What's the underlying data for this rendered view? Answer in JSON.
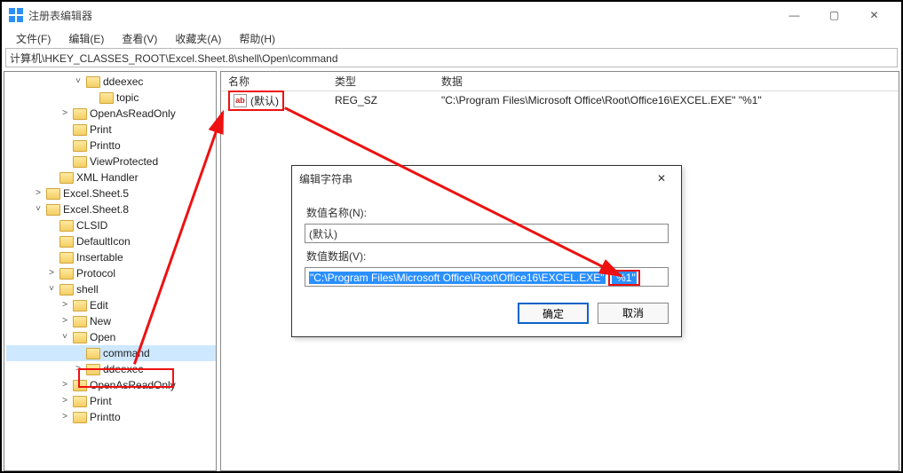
{
  "window": {
    "title": "注册表编辑器",
    "controls": {
      "min": "—",
      "max": "▢",
      "close": "✕"
    }
  },
  "menu": [
    "文件(F)",
    "编辑(E)",
    "查看(V)",
    "收藏夹(A)",
    "帮助(H)"
  ],
  "address": "计算机\\HKEY_CLASSES_ROOT\\Excel.Sheet.8\\shell\\Open\\command",
  "tree": [
    {
      "indent": 5,
      "exp": "v",
      "label": "ddeexec"
    },
    {
      "indent": 6,
      "exp": "",
      "label": "topic"
    },
    {
      "indent": 4,
      "exp": ">",
      "label": "OpenAsReadOnly"
    },
    {
      "indent": 4,
      "exp": "",
      "label": "Print"
    },
    {
      "indent": 4,
      "exp": "",
      "label": "Printto"
    },
    {
      "indent": 4,
      "exp": "",
      "label": "ViewProtected"
    },
    {
      "indent": 3,
      "exp": "",
      "label": "XML Handler"
    },
    {
      "indent": 2,
      "exp": ">",
      "label": "Excel.Sheet.5"
    },
    {
      "indent": 2,
      "exp": "v",
      "label": "Excel.Sheet.8"
    },
    {
      "indent": 3,
      "exp": "",
      "label": "CLSID"
    },
    {
      "indent": 3,
      "exp": "",
      "label": "DefaultIcon"
    },
    {
      "indent": 3,
      "exp": "",
      "label": "Insertable"
    },
    {
      "indent": 3,
      "exp": ">",
      "label": "Protocol"
    },
    {
      "indent": 3,
      "exp": "v",
      "label": "shell"
    },
    {
      "indent": 4,
      "exp": ">",
      "label": "Edit"
    },
    {
      "indent": 4,
      "exp": ">",
      "label": "New"
    },
    {
      "indent": 4,
      "exp": "v",
      "label": "Open"
    },
    {
      "indent": 5,
      "exp": "",
      "label": "command",
      "hl": true
    },
    {
      "indent": 5,
      "exp": ">",
      "label": "ddeexec"
    },
    {
      "indent": 4,
      "exp": ">",
      "label": "OpenAsReadOnly"
    },
    {
      "indent": 4,
      "exp": ">",
      "label": "Print"
    },
    {
      "indent": 4,
      "exp": ">",
      "label": "Printto"
    }
  ],
  "list": {
    "headers": {
      "name": "名称",
      "type": "类型",
      "data": "数据"
    },
    "row": {
      "name": "(默认)",
      "type": "REG_SZ",
      "data": "\"C:\\Program Files\\Microsoft Office\\Root\\Office16\\EXCEL.EXE\" \"%1\""
    }
  },
  "dialog": {
    "title": "编辑字符串",
    "name_label": "数值名称(N):",
    "name_value": "(默认)",
    "data_label": "数值数据(V):",
    "data_prefix": "\"C:\\Program Files\\Microsoft Office\\Root\\Office16\\EXCEL.EXE\"",
    "data_suffix": "\"%1\"",
    "ok": "确定",
    "cancel": "取消"
  }
}
